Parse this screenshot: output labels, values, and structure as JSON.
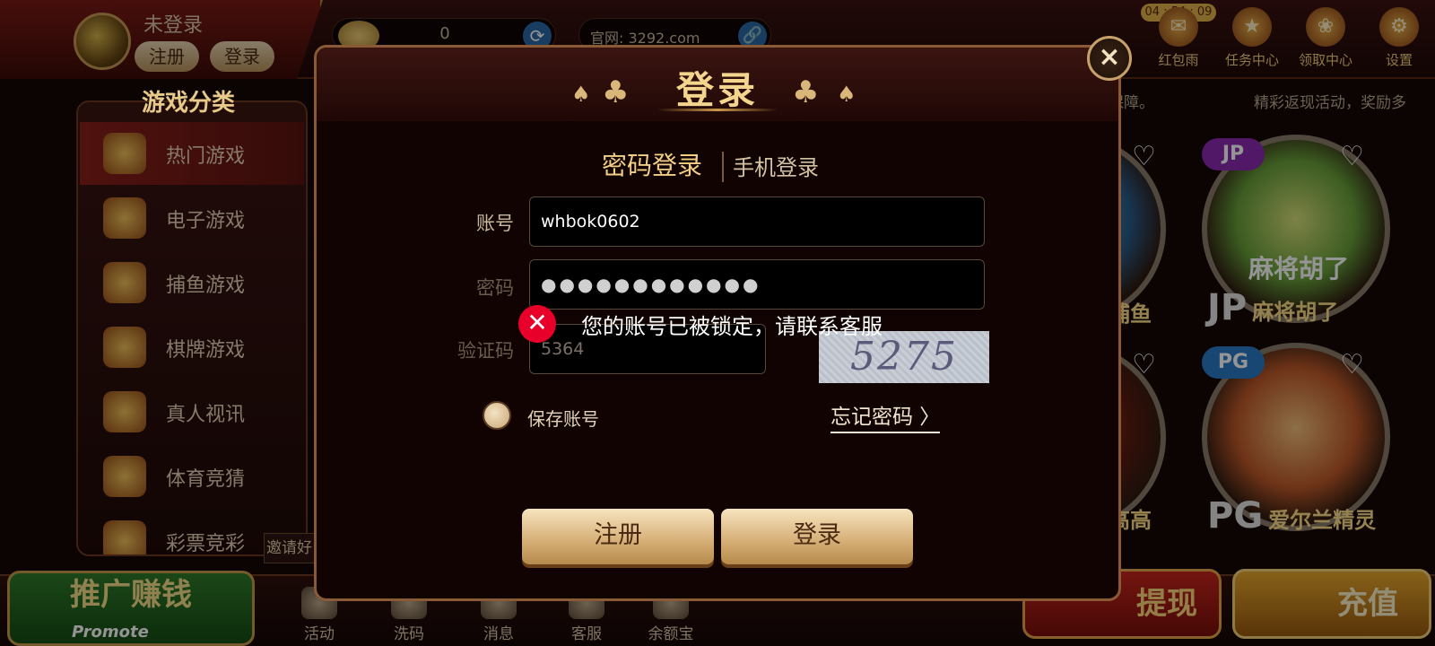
{
  "user": {
    "status": "未登录",
    "register_label": "注册",
    "login_label": "登录"
  },
  "balance": {
    "value": "0"
  },
  "site": {
    "text": "官网: 3292.com"
  },
  "top_icons": [
    {
      "label": "红包雨",
      "icon": "red-envelope-icon"
    },
    {
      "label": "任务中心",
      "icon": "task-icon"
    },
    {
      "label": "领取中心",
      "icon": "gift-icon"
    },
    {
      "label": "设置",
      "icon": "gear-icon"
    }
  ],
  "timer": "04 : 54 : 09",
  "marquee": {
    "left": "保障。",
    "right": "精彩返现活动，奖励多"
  },
  "categories": {
    "title": "游戏分类",
    "items": [
      {
        "label": "热门游戏"
      },
      {
        "label": "电子游戏"
      },
      {
        "label": "捕鱼游戏"
      },
      {
        "label": "棋牌游戏"
      },
      {
        "label": "真人视讯"
      },
      {
        "label": "体育竞猜"
      },
      {
        "label": "彩票竞彩"
      }
    ]
  },
  "invite_tip": "邀请好",
  "games": [
    {
      "prefix": "",
      "name": "捕鱼"
    },
    {
      "prefix": "JP",
      "name": "麻将胡了",
      "badge": "JP",
      "art_text": "麻将胡了"
    },
    {
      "prefix": "",
      "name": "高高"
    },
    {
      "prefix": "PG",
      "name": "爱尔兰精灵",
      "badge": "PG"
    }
  ],
  "bottom_nav": {
    "promote": {
      "title": "推广赚钱",
      "subtitle": "Promote"
    },
    "items": [
      {
        "label": "活动"
      },
      {
        "label": "洗码"
      },
      {
        "label": "消息"
      },
      {
        "label": "客服"
      },
      {
        "label": "余额宝"
      }
    ],
    "withdraw": "提现",
    "recharge": "充值"
  },
  "modal": {
    "title": "登录",
    "close_icon": "×",
    "tabs": {
      "active": "密码登录",
      "inactive": "手机登录"
    },
    "fields": {
      "account": {
        "label": "账号",
        "value": "whbok0602"
      },
      "password": {
        "label": "密码",
        "value": "●●●●●●●●●●●●"
      },
      "captcha": {
        "label": "验证码",
        "value": "5364",
        "image_text": "5275"
      }
    },
    "remember_label": "保存账号",
    "forgot_label": "忘记密码 〉",
    "register_button": "注册",
    "login_button": "登录",
    "toast": {
      "icon": "✕",
      "message": "您的账号已被锁定，请联系客服"
    }
  },
  "colors": {
    "accent_gold": "#f3d58e",
    "error_red": "#e8002a",
    "modal_bg": "#100302"
  }
}
